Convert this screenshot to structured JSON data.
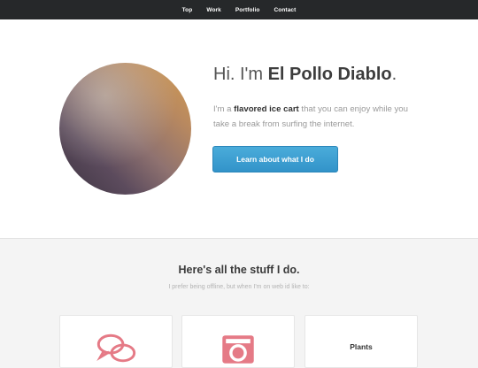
{
  "nav": {
    "items": [
      {
        "label": "Top"
      },
      {
        "label": "Work"
      },
      {
        "label": "Portfolio"
      },
      {
        "label": "Contact"
      }
    ]
  },
  "hero": {
    "title_prefix": "Hi. I'm ",
    "title_name": "El Pollo Diablo",
    "title_suffix": ".",
    "text_prefix": "I'm a ",
    "text_bold": "flavored ice cart",
    "text_suffix": " that you can enjoy while you take a break from surfing the internet.",
    "cta_label": "Learn about what I do"
  },
  "services": {
    "title": "Here's all the stuff I do.",
    "subtitle": "I prefer being offline, but when I'm on web id like to:",
    "cards": [
      {
        "icon": "chat-bubbles-icon",
        "label": ""
      },
      {
        "icon": "camera-icon",
        "label": ""
      },
      {
        "icon": "",
        "label": "Plants"
      }
    ]
  },
  "colors": {
    "nav_bg": "#26282a",
    "accent_button": "#3a9fd3",
    "icon_pink": "#e57a86"
  }
}
